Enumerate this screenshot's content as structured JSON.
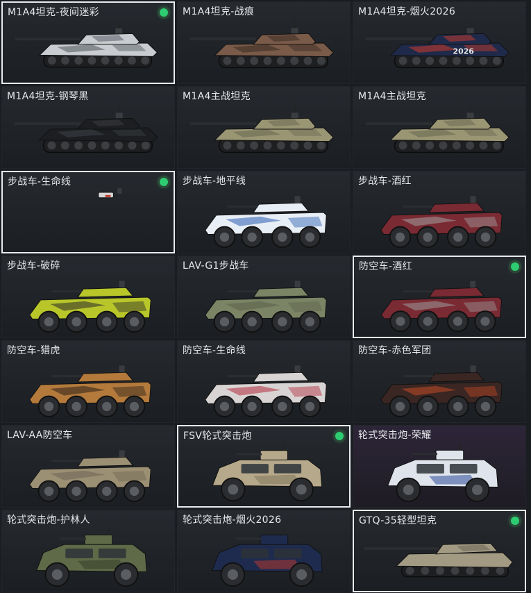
{
  "vehicles": [
    {
      "name": "M1A4坦克-夜间迷彩",
      "kind": "tank",
      "color": "#c9ccd0",
      "accent": "#5a5f66",
      "selected": true,
      "equipped": true,
      "rare": false
    },
    {
      "name": "M1A4坦克-战痕",
      "kind": "tank",
      "color": "#7a5a48",
      "accent": "#3b2d25",
      "selected": false,
      "equipped": false,
      "rare": false
    },
    {
      "name": "M1A4坦克-烟火2026",
      "kind": "tank",
      "color": "#1f2a4a",
      "accent": "#c0392b",
      "selected": false,
      "equipped": false,
      "rare": false,
      "decal": "2026"
    },
    {
      "name": "M1A4坦克-钢琴黑",
      "kind": "tank",
      "color": "#1c1e21",
      "accent": "#3a3d42",
      "selected": false,
      "equipped": false,
      "rare": false
    },
    {
      "name": "M1A4主战坦克",
      "kind": "tank",
      "color": "#9a9674",
      "accent": "#6c6a52",
      "selected": false,
      "equipped": false,
      "rare": false
    },
    {
      "name": "M1A4主战坦克",
      "kind": "tank",
      "color": "#9a9674",
      "accent": "#6c6a52",
      "selected": false,
      "equipped": false,
      "rare": false
    },
    {
      "name": "步战车-生命线",
      "kind": "small",
      "color": "#d8d8d8",
      "accent": "#c0392b",
      "selected": true,
      "equipped": true,
      "rare": false
    },
    {
      "name": "步战车-地平线",
      "kind": "apc",
      "color": "#e8eef5",
      "accent": "#2a5db0",
      "selected": false,
      "equipped": false,
      "rare": false
    },
    {
      "name": "步战车-酒红",
      "kind": "apc",
      "color": "#7a2a33",
      "accent": "#a0a0a0",
      "selected": false,
      "equipped": false,
      "rare": false
    },
    {
      "name": "步战车-破碎",
      "kind": "apc",
      "color": "#b8c62a",
      "accent": "#2a2a2a",
      "selected": false,
      "equipped": false,
      "rare": false
    },
    {
      "name": "LAV-G1步战车",
      "kind": "apc",
      "color": "#7c8466",
      "accent": "#5b6149",
      "selected": false,
      "equipped": false,
      "rare": false
    },
    {
      "name": "防空车-酒红",
      "kind": "apc",
      "color": "#7a2a33",
      "accent": "#9a9a9a",
      "selected": true,
      "equipped": true,
      "rare": false
    },
    {
      "name": "防空车-猎虎",
      "kind": "apc",
      "color": "#b37a3c",
      "accent": "#2a1f18",
      "selected": false,
      "equipped": false,
      "rare": false
    },
    {
      "name": "防空车-生命线",
      "kind": "apc",
      "color": "#d9d4d4",
      "accent": "#b02a3a",
      "selected": false,
      "equipped": false,
      "rare": false
    },
    {
      "name": "防空车-赤色军团",
      "kind": "apc",
      "color": "#3a2622",
      "accent": "#c24a26",
      "selected": false,
      "equipped": false,
      "rare": false
    },
    {
      "name": "LAV-AA防空车",
      "kind": "apc",
      "color": "#9b8f74",
      "accent": "#6e6553",
      "selected": false,
      "equipped": false,
      "rare": false
    },
    {
      "name": "FSV轮式突击炮",
      "kind": "armored",
      "color": "#b6a88a",
      "accent": "#7a6f58",
      "selected": true,
      "equipped": true,
      "rare": false
    },
    {
      "name": "轮式突击炮-荣耀",
      "kind": "armored",
      "color": "#dfe4ec",
      "accent": "#1d3d8f",
      "selected": false,
      "equipped": false,
      "rare": true
    },
    {
      "name": "轮式突击炮-护林人",
      "kind": "armored",
      "color": "#5e6a48",
      "accent": "#2f3a26",
      "selected": false,
      "equipped": false,
      "rare": false
    },
    {
      "name": "轮式突击炮-烟火2026",
      "kind": "armored",
      "color": "#1e2b4e",
      "accent": "#c0392b",
      "selected": false,
      "equipped": false,
      "rare": false
    },
    {
      "name": "GTQ-35轻型坦克",
      "kind": "light",
      "color": "#a39a84",
      "accent": "#6e6756",
      "selected": true,
      "equipped": true,
      "rare": false
    }
  ]
}
